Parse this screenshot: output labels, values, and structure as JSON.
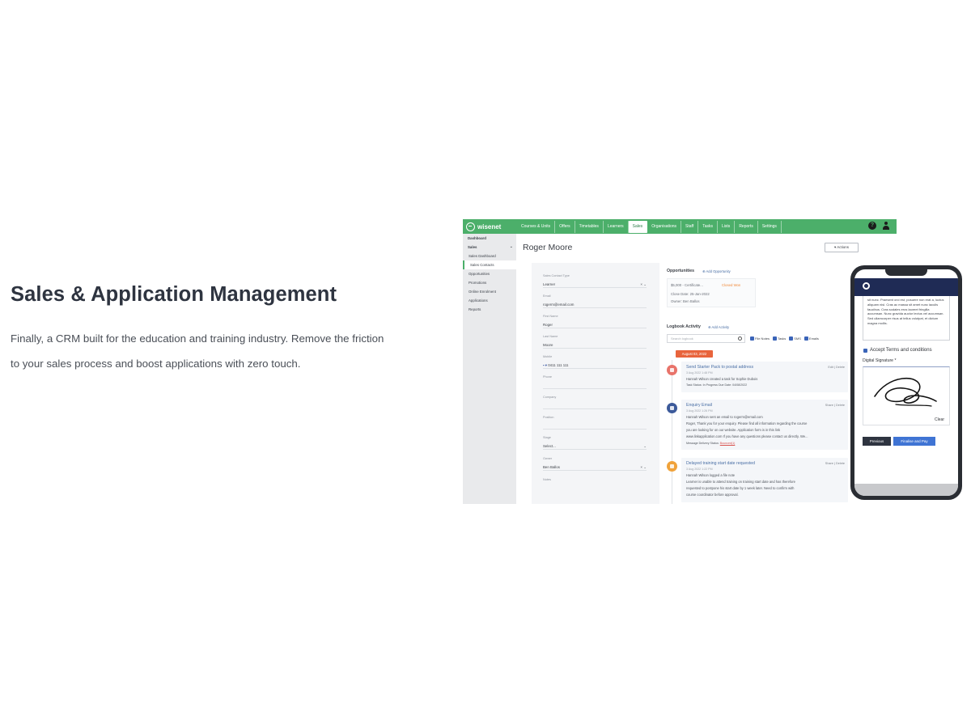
{
  "hero": {
    "title": "Sales & Application Management",
    "body": "Finally, a CRM built for the education and training industry. Remove the friction to your sales process and boost applications with zero touch."
  },
  "app": {
    "brand": "wisenet",
    "nav": [
      "Courses & Units",
      "Offers",
      "Timetables",
      "Learners",
      "Sales",
      "Organisations",
      "Staff",
      "Tasks",
      "Lists",
      "Reports",
      "Settings"
    ],
    "nav_active": "Sales",
    "help_icon": "?",
    "sidebar": [
      {
        "label": "Dashboard",
        "type": "head"
      },
      {
        "label": "Sales",
        "type": "head"
      },
      {
        "label": "Sales Dashboard",
        "type": "sub"
      },
      {
        "label": "Sales Contacts",
        "type": "sub"
      },
      {
        "label": "Opportunities",
        "type": "sub"
      },
      {
        "label": "Promotions",
        "type": "sub"
      },
      {
        "label": "Online Enrolment",
        "type": "sub"
      },
      {
        "label": "Applications",
        "type": "sub"
      },
      {
        "label": "Reports",
        "type": "sub"
      }
    ],
    "contact_name": "Roger Moore",
    "actions_label": "▾ Actions",
    "form": {
      "contact_type_label": "Sales Contact Type",
      "contact_type_value": "Learner",
      "email_label": "Email",
      "email_value": "rogerm@email.com",
      "first_name_label": "First Name",
      "first_name_value": "Roger",
      "last_name_label": "Last Name",
      "last_name_value": "Moore",
      "mobile_label": "Mobile",
      "mobile_value": "0411 111 111",
      "phone_label": "Phone",
      "company_label": "Company",
      "position_label": "Position",
      "stage_label": "Stage",
      "stage_value": "Select...",
      "owner_label": "Owner",
      "owner_value": "Ben Ballos",
      "notes_label": "Notes"
    },
    "opportunities": {
      "title": "Opportunities",
      "add_label": "Add Opportunity",
      "card_title": "$5,000 - Certificate...",
      "card_status": "Closed Won",
      "card_close": "Close Date: 25-Jan-2022",
      "card_owner": "Owner: Ben Ballos"
    },
    "logbook": {
      "title": "Logbook Activity",
      "add_label": "Add Activity",
      "search_placeholder": "Search logbook",
      "filters": [
        "File Notes",
        "Tasks",
        "SMS",
        "Emails"
      ],
      "date_badge": "August 03, 2022",
      "entries": [
        {
          "title": "Send Starter Pack to postal address",
          "edit": "Edit | Delete",
          "date": "3 Aug 2022 1:48 PM",
          "lines": [
            "Hannah Wilson created a task for Sophie Dubois",
            "Task Status: In Progress   Due Date: 04/08/2022"
          ],
          "color": "#e8736a"
        },
        {
          "title": "Enquiry Email",
          "edit": "Share | Delete",
          "date": "3 Aug 2022 1:26 PM",
          "lines": [
            "Hannah Wilson sent an email to rogerm@email.com",
            "Roger, Thank you for your enquiry. Please find all information regarding the course",
            "you are looking for on our website. Application form is in this link",
            "www.linkapplication.com If you have any questions please contact us directly. We...",
            "Message Delivery Status: "
          ],
          "delivery_status": "Bounced(1)",
          "color": "#3c5a9a"
        },
        {
          "title": "Delayed training start date requested",
          "edit": "Share | Delete",
          "date": "3 Aug 2022 1:22 PM",
          "lines": [
            "Hannah Wilson logged a file note",
            "Learner is unable to attend training on training start date and has therefore",
            "requested to postpone his start date by 1 week later. Need to confirm with",
            "course coordinator before approval."
          ],
          "color": "#f0a23a"
        }
      ]
    }
  },
  "phone": {
    "terms_text": "sit nunc. Praesent orci est, posuere non erat a, luctus aliquam nisl. Cras ac massa sit amet nunc iaculis faucibus. Cras sodales eros laoreet fringilla accumsan. Nunc gravida auctor lectus vel accumsan. Sed ullamcorper risus at tellus volutpat, et dictum magna mollis.",
    "accept_label": "Accept Terms and conditions",
    "signature_label": "Digital Signature *",
    "clear_label": "Clear",
    "previous_label": "Previous",
    "pay_label": "Finalise and Pay"
  }
}
